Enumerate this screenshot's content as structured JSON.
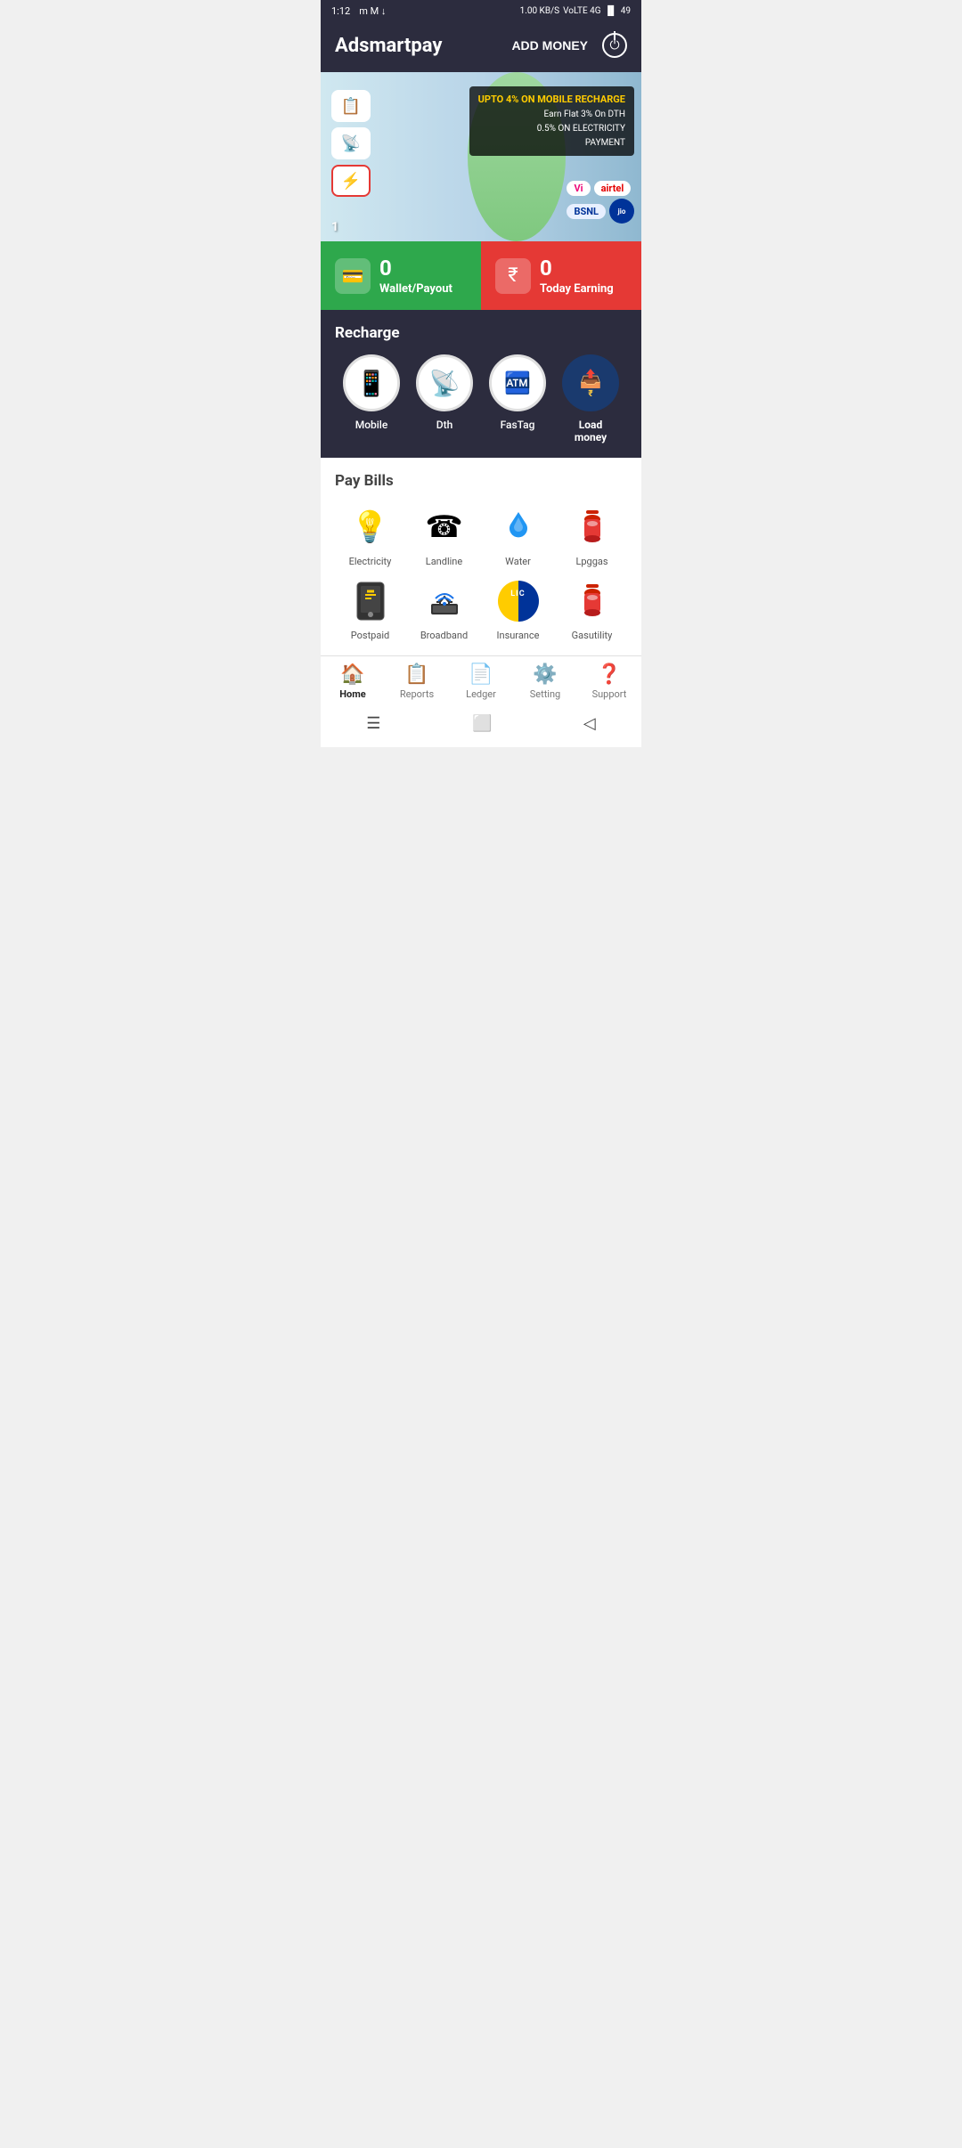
{
  "statusBar": {
    "time": "1:12",
    "icons": "m M ↓",
    "networkSpeed": "1.00 KB/S",
    "networkType": "VoLTE 4G",
    "battery": "49"
  },
  "header": {
    "appName": "Adsmartpay",
    "addMoneyLabel": "ADD MONEY"
  },
  "banner": {
    "line1": "UPTO 4% ON MOBILE RECHARGE",
    "line2": "Earn Flat 3% On DTH",
    "line3": "0.5% ON ELECTRICITY",
    "line4": "PAYMENT",
    "counter": "1"
  },
  "wallet": {
    "balance": "0",
    "walletLabel": "Wallet/Payout",
    "earning": "0",
    "earningLabel": "Today Earning",
    "currency": "₹"
  },
  "recharge": {
    "sectionTitle": "Recharge",
    "items": [
      {
        "label": "Mobile",
        "icon": "📱"
      },
      {
        "label": "Dth",
        "icon": "📡"
      },
      {
        "label": "FasTag",
        "icon": "🏧"
      },
      {
        "label": "Load\nmoney",
        "icon": "💳"
      }
    ]
  },
  "payBills": {
    "sectionTitle": "Pay Bills",
    "items": [
      {
        "label": "Electricity",
        "icon": "💡"
      },
      {
        "label": "Landline",
        "icon": "☎"
      },
      {
        "label": "Water",
        "icon": "🏠"
      },
      {
        "label": "Lpggas",
        "icon": "🔴"
      },
      {
        "label": "Postpaid",
        "icon": "📱"
      },
      {
        "label": "Broadband",
        "icon": "📶"
      },
      {
        "label": "Insurance",
        "icon": "🛡"
      },
      {
        "label": "Gasutility",
        "icon": "🔴"
      }
    ]
  },
  "bottomNav": {
    "items": [
      {
        "label": "Home",
        "icon": "🏠",
        "active": true
      },
      {
        "label": "Reports",
        "icon": "📋",
        "active": false
      },
      {
        "label": "Ledger",
        "icon": "📄",
        "active": false
      },
      {
        "label": "Setting",
        "icon": "⚙",
        "active": false
      },
      {
        "label": "Support",
        "icon": "❓",
        "active": false
      }
    ]
  },
  "androidNav": {
    "menu": "☰",
    "home": "⬜",
    "back": "◁"
  }
}
